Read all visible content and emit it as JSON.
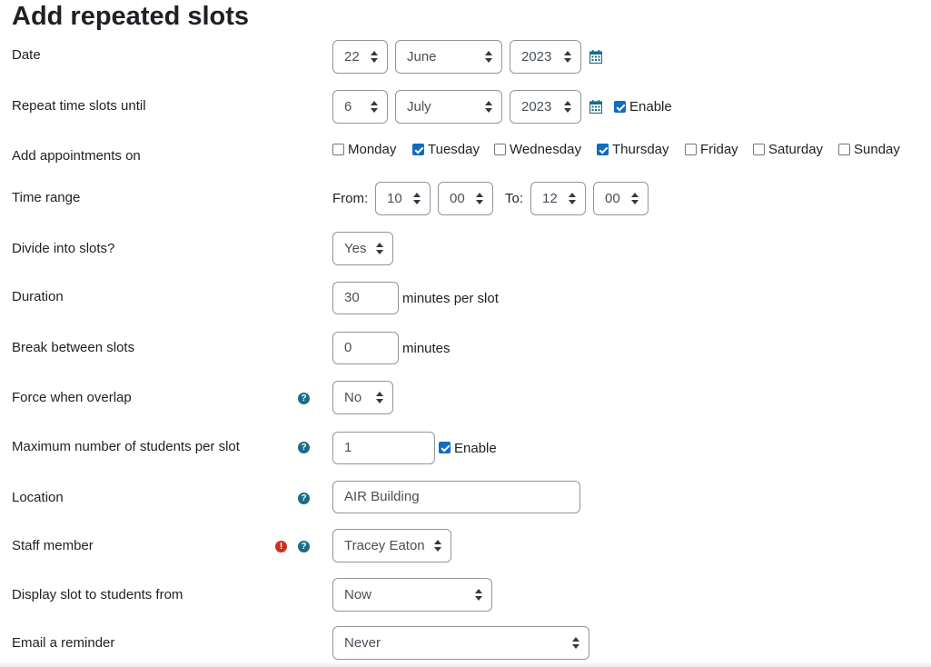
{
  "page": {
    "title": "Add repeated slots"
  },
  "labels": {
    "date": "Date",
    "repeat_until": "Repeat time slots until",
    "add_on": "Add appointments on",
    "time_range": "Time range",
    "divide": "Divide into slots?",
    "duration": "Duration",
    "break": "Break between slots",
    "force": "Force when overlap",
    "max_students": "Maximum number of students per slot",
    "location": "Location",
    "staff": "Staff member",
    "display_from": "Display slot to students from",
    "email_reminder": "Email a reminder"
  },
  "date": {
    "day": "22",
    "month": "June",
    "year": "2023"
  },
  "repeat_until": {
    "day": "6",
    "month": "July",
    "year": "2023",
    "enable_label": "Enable",
    "enabled": true
  },
  "days": [
    {
      "label": "Monday",
      "checked": false
    },
    {
      "label": "Tuesday",
      "checked": true
    },
    {
      "label": "Wednesday",
      "checked": false
    },
    {
      "label": "Thursday",
      "checked": true
    },
    {
      "label": "Friday",
      "checked": false
    },
    {
      "label": "Saturday",
      "checked": false
    },
    {
      "label": "Sunday",
      "checked": false
    }
  ],
  "time_range": {
    "from_label": "From:",
    "from_hour": "10",
    "from_min": "00",
    "to_label": "To:",
    "to_hour": "12",
    "to_min": "00"
  },
  "divide": {
    "value": "Yes"
  },
  "duration": {
    "value": "30",
    "suffix": "minutes per slot"
  },
  "break": {
    "value": "0",
    "suffix": "minutes"
  },
  "force": {
    "value": "No"
  },
  "max_students": {
    "value": "1",
    "enable_label": "Enable",
    "enabled": true
  },
  "location": {
    "value": "AIR Building"
  },
  "staff": {
    "value": "Tracey Eaton"
  },
  "display_from": {
    "value": "Now"
  },
  "email_reminder": {
    "value": "Never"
  },
  "icons": {
    "help": "question-circle-icon",
    "required": "exclamation-circle-icon",
    "calendar": "calendar-icon"
  },
  "colors": {
    "accent": "#0f6cbf",
    "help": "#186e84",
    "required": "#ca3120"
  }
}
